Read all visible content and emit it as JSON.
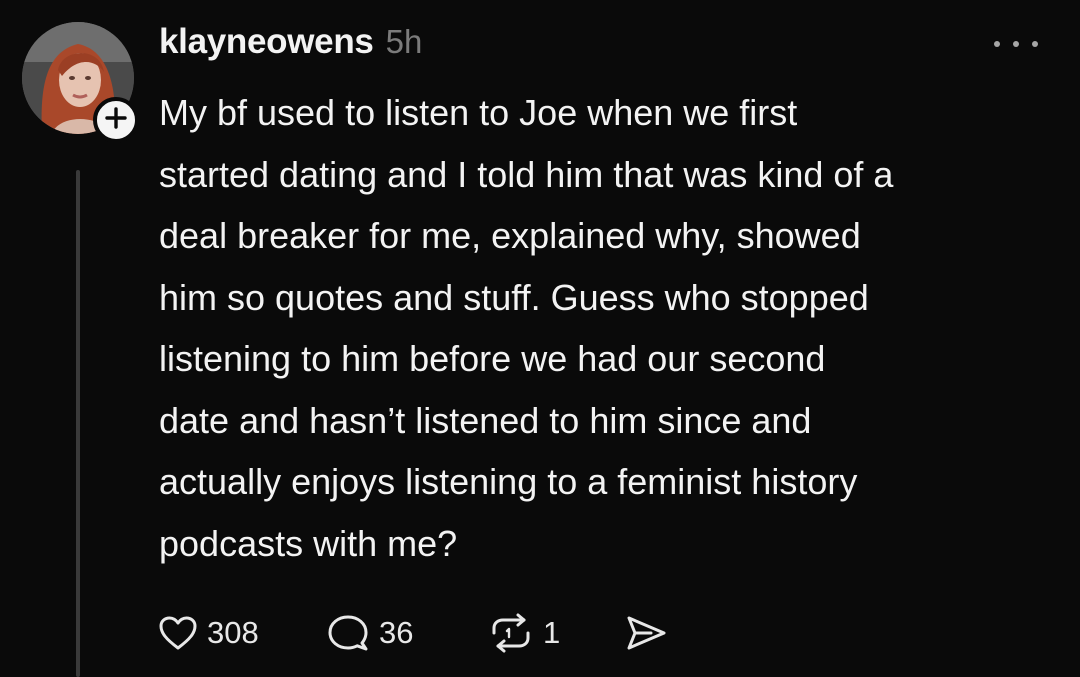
{
  "post": {
    "username": "klayneowens",
    "timestamp": "5h",
    "text": "My bf used to listen to Joe when we first\nstarted dating and I told him that was kind of a\ndeal breaker for me, explained why, showed\nhim so quotes and stuff. Guess who stopped\nlistening to him before we had our second\ndate and hasn’t listened to him since and\nactually enjoys listening to a feminist history\npodcasts with me?"
  },
  "actions": {
    "likes": "308",
    "replies": "36",
    "reposts": "1"
  },
  "icons": {
    "like": "heart-icon",
    "reply": "speech-bubble-icon",
    "repost": "repost-icon",
    "share": "send-icon",
    "more": "more-icon",
    "follow": "plus-icon"
  },
  "colors": {
    "background": "#0a0a0a",
    "text": "#f3f3f3",
    "muted": "#7b7b7b",
    "thread_line": "#3a3a3a"
  }
}
